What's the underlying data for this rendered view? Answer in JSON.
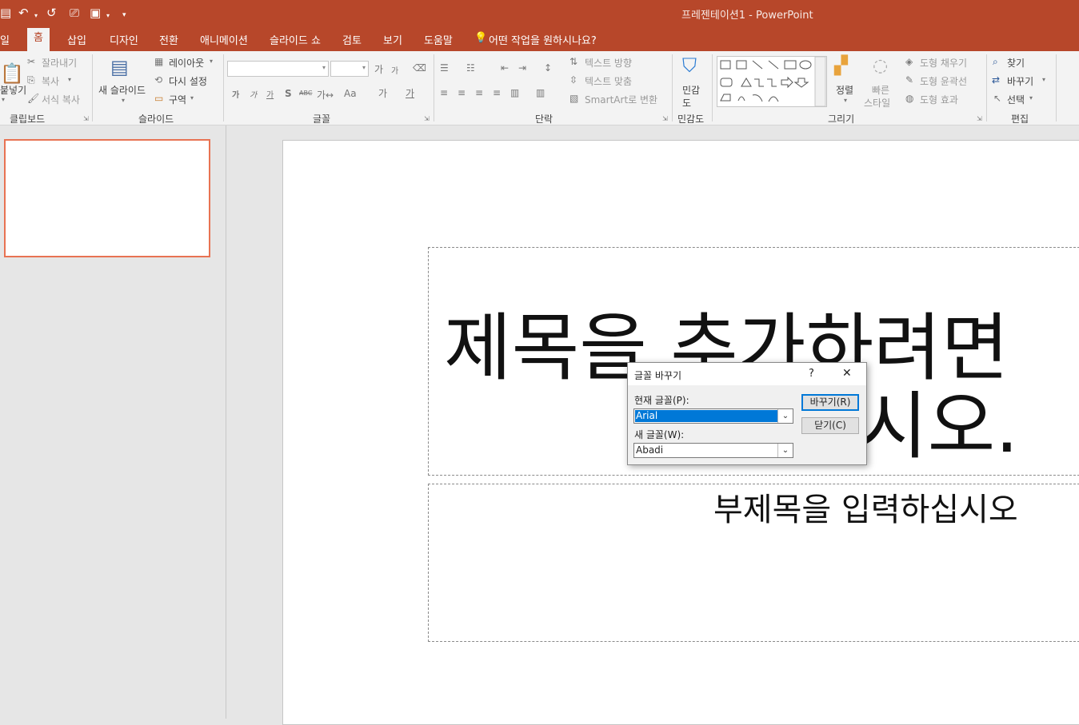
{
  "window": {
    "title": "프레젠테이션1 - PowerPoint"
  },
  "qat": {
    "icons": [
      "save-icon",
      "undo-icon",
      "redo-icon",
      "present-icon",
      "layout-icon",
      "customize-icon"
    ]
  },
  "menu": {
    "tabs": [
      "일",
      "홈",
      "삽입",
      "디자인",
      "전환",
      "애니메이션",
      "슬라이드 쇼",
      "검토",
      "보기",
      "도움말"
    ],
    "tell_me": "어떤 작업을 원하시나요?"
  },
  "ribbon": {
    "clipboard": {
      "paste": "붙넣기",
      "cut": "잘라내기",
      "copy": "복사",
      "format_painter": "서식 복사",
      "group": "클립보드"
    },
    "slides": {
      "new_slide": "새 슬라이드",
      "layout": "레이아웃",
      "reset": "다시 설정",
      "section": "구역",
      "group": "슬라이드"
    },
    "font": {
      "group": "글꼴",
      "row1": [
        "가",
        "가",
        "가",
        "S",
        "ABC",
        "가↔",
        "Aa",
        "가",
        "가"
      ]
    },
    "paragraph": {
      "text_direction": "텍스트 방향",
      "align_text": "텍스트 맞춤",
      "smartart": "SmartArt로 변환",
      "group": "단락"
    },
    "sensitivity": {
      "label1": "민감",
      "label2": "도",
      "group": "민감도"
    },
    "drawing": {
      "arrange": "정렬",
      "quick_styles1": "빠른",
      "quick_styles2": "스타일",
      "fill": "도형 채우기",
      "outline": "도형 윤곽선",
      "effects": "도형 효과",
      "group": "그리기"
    },
    "editing": {
      "find": "찾기",
      "replace": "바꾸기",
      "select": "선택",
      "group": "편집"
    }
  },
  "slide": {
    "title_line1": "제목을 추가하려면 ",
    "title_line2": "시오.",
    "subtitle": "부제목을 입력하십시오"
  },
  "dialog": {
    "title": "글꼴 바꾸기",
    "help": "?",
    "close": "✕",
    "current_label": "현재 글꼴(P):",
    "current_value": "Arial",
    "new_label": "새 글꼴(W):",
    "new_value": "Abadi",
    "replace_button": "바꾸기(R)",
    "close_button": "닫기(C)"
  },
  "colors": {
    "accent": "#b7472a",
    "selection": "#0078d7",
    "thumb_border": "#e87353"
  }
}
